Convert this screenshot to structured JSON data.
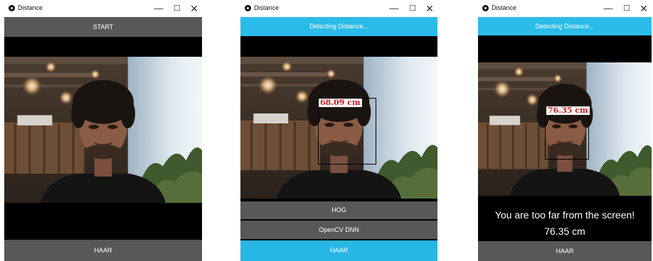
{
  "window_title": "Distance",
  "window_controls": {
    "minimize": "—",
    "maximize": "☐",
    "close": "✕"
  },
  "panel1": {
    "start_label": "START",
    "haar_label": "HAAR"
  },
  "panel2": {
    "status_label": "Detecting Distance...",
    "distance_label": "68.09 cm",
    "hog_label": "HOG",
    "dnn_label": "OpenCV DNN",
    "haar_label": "HAAR"
  },
  "panel3": {
    "status_label": "Detecting Distance...",
    "distance_label": "76.35 cm",
    "message": "You are too far from the screen!",
    "distance_value": "76.35 cm",
    "haar_label": "HAAR"
  },
  "colors": {
    "accent_blue": "#2bbbe8",
    "button_grey": "#585858",
    "distance_text": "#d11d1d"
  }
}
